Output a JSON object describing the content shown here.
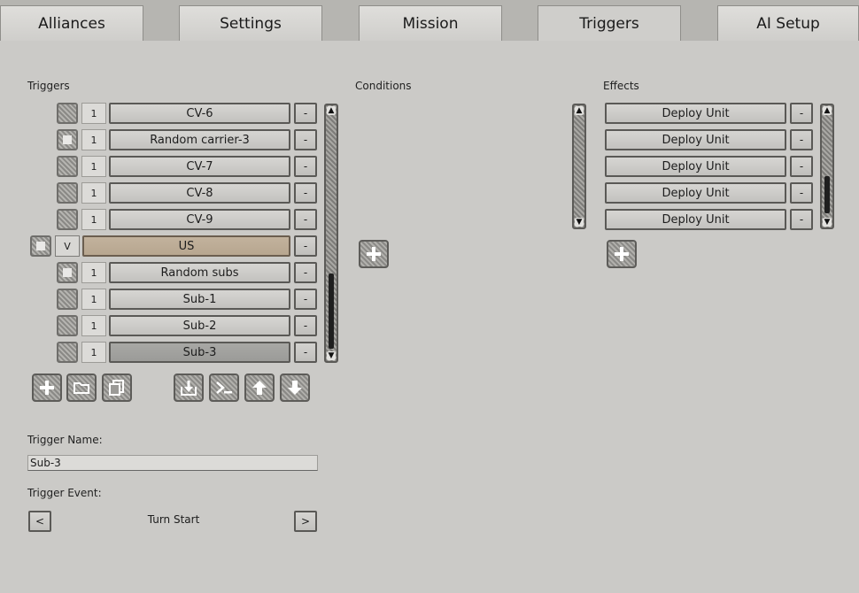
{
  "tabs": [
    {
      "label": "Alliances",
      "active": false
    },
    {
      "label": "Settings",
      "active": false
    },
    {
      "label": "Mission",
      "active": false
    },
    {
      "label": "Triggers",
      "active": true
    },
    {
      "label": "AI Setup",
      "active": false
    }
  ],
  "triggers_panel": {
    "label": "Triggers",
    "rows": [
      {
        "count": "1",
        "name": "CV-6",
        "checked": false
      },
      {
        "count": "1",
        "name": "Random carrier-3",
        "checked": true
      },
      {
        "count": "1",
        "name": "CV-7",
        "checked": false
      },
      {
        "count": "1",
        "name": "CV-8",
        "checked": false
      },
      {
        "count": "1",
        "name": "CV-9",
        "checked": false
      },
      {
        "count": "V",
        "name": "US",
        "checked": true,
        "group": true
      },
      {
        "count": "1",
        "name": "Random subs",
        "checked": true
      },
      {
        "count": "1",
        "name": "Sub-1",
        "checked": false
      },
      {
        "count": "1",
        "name": "Sub-2",
        "checked": false
      },
      {
        "count": "1",
        "name": "Sub-3",
        "checked": false,
        "selected": true
      }
    ],
    "remove_label": "-"
  },
  "toolbar_icons": [
    "add-icon",
    "folder-icon",
    "duplicate-icon",
    "import-icon",
    "console-icon",
    "arrow-up-icon",
    "arrow-down-icon"
  ],
  "conditions_panel": {
    "label": "Conditions"
  },
  "effects_panel": {
    "label": "Effects",
    "rows": [
      {
        "name": "Deploy Unit"
      },
      {
        "name": "Deploy Unit"
      },
      {
        "name": "Deploy Unit"
      },
      {
        "name": "Deploy Unit"
      },
      {
        "name": "Deploy Unit"
      }
    ],
    "remove_label": "-"
  },
  "trigger_name": {
    "label": "Trigger Name:",
    "value": "Sub-3"
  },
  "trigger_event": {
    "label": "Trigger Event:",
    "value": "Turn Start",
    "prev_label": "<",
    "next_label": ">"
  },
  "colors": {
    "background": "#cbcac7",
    "group_row": "#bcac96",
    "selected_row": "#a3a3a0"
  }
}
